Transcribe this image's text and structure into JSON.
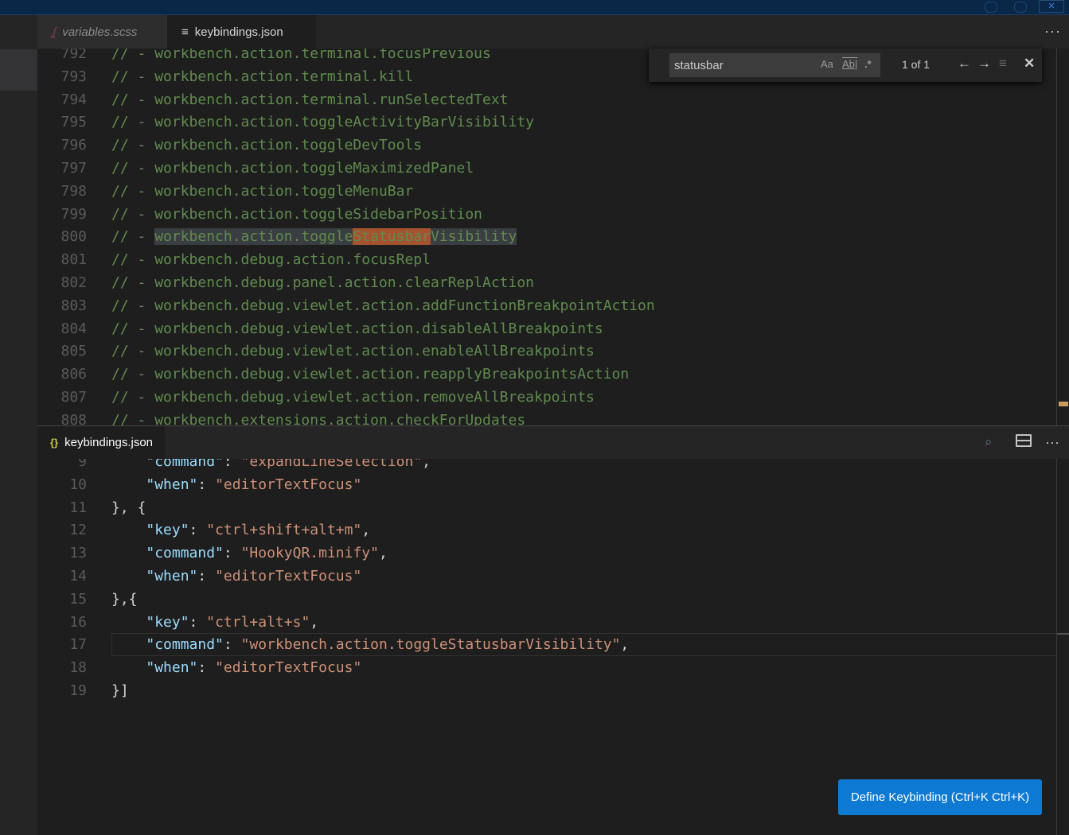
{
  "colors": {
    "accent": "#0e7ad3",
    "comment": "#608b4e",
    "json_key": "#9cdcfe",
    "json_string": "#ce9178",
    "match_highlight": "#a5532f"
  },
  "titlebar": {
    "close_label": "✕"
  },
  "tabs": [
    {
      "label": "variables.scss",
      "icon": "sass-icon",
      "active": false
    },
    {
      "label": "keybindings.json",
      "icon": "file-lines-icon",
      "active": true
    }
  ],
  "tabs_more": "···",
  "find": {
    "value": "statusbar",
    "match_case": "Aa",
    "whole_word": "Ab|",
    "regex": ".*",
    "count": "1 of 1",
    "prev": "←",
    "next": "→",
    "selection": "≡",
    "close": "✕"
  },
  "top_editor": {
    "lines": [
      {
        "n": "792",
        "prefix": "// - ",
        "text": "workbench.action.terminal.focusPrevious"
      },
      {
        "n": "793",
        "prefix": "// - ",
        "text": "workbench.action.terminal.kill"
      },
      {
        "n": "794",
        "prefix": "// - ",
        "text": "workbench.action.terminal.runSelectedText"
      },
      {
        "n": "795",
        "prefix": "// - ",
        "text": "workbench.action.toggleActivityBarVisibility"
      },
      {
        "n": "796",
        "prefix": "// - ",
        "text": "workbench.action.toggleDevTools"
      },
      {
        "n": "797",
        "prefix": "// - ",
        "text": "workbench.action.toggleMaximizedPanel"
      },
      {
        "n": "798",
        "prefix": "// - ",
        "text": "workbench.action.toggleMenuBar"
      },
      {
        "n": "799",
        "prefix": "// - ",
        "text": "workbench.action.toggleSidebarPosition"
      },
      {
        "n": "800",
        "prefix": "// - ",
        "text_pre": "workbench.action.toggle",
        "text_match": "Statusbar",
        "text_post": "Visibility"
      },
      {
        "n": "801",
        "prefix": "// - ",
        "text": "workbench.debug.action.focusRepl"
      },
      {
        "n": "802",
        "prefix": "// - ",
        "text": "workbench.debug.panel.action.clearReplAction"
      },
      {
        "n": "803",
        "prefix": "// - ",
        "text": "workbench.debug.viewlet.action.addFunctionBreakpointAction"
      },
      {
        "n": "804",
        "prefix": "// - ",
        "text": "workbench.debug.viewlet.action.disableAllBreakpoints"
      },
      {
        "n": "805",
        "prefix": "// - ",
        "text": "workbench.debug.viewlet.action.enableAllBreakpoints"
      },
      {
        "n": "806",
        "prefix": "// - ",
        "text": "workbench.debug.viewlet.action.reapplyBreakpointsAction"
      },
      {
        "n": "807",
        "prefix": "// - ",
        "text": "workbench.debug.viewlet.action.removeAllBreakpoints"
      },
      {
        "n": "808",
        "prefix": "// - ",
        "text": "workbench.extensions.action.checkForUpdates"
      }
    ]
  },
  "panel": {
    "tab_label": "keybindings.json",
    "tab_icon": "{}",
    "more": "···"
  },
  "bottom_editor": {
    "lines": [
      {
        "n": "9",
        "indent": "    ",
        "key": "\"command\"",
        "sep": ": ",
        "value": "\"expandLineSelection\"",
        "tail": ","
      },
      {
        "n": "10",
        "indent": "    ",
        "key": "\"when\"",
        "sep": ": ",
        "value": "\"editorTextFocus\"",
        "tail": ""
      },
      {
        "n": "11",
        "indent": "",
        "punc": "}, {"
      },
      {
        "n": "12",
        "indent": "    ",
        "key": "\"key\"",
        "sep": ": ",
        "value": "\"ctrl+shift+alt+m\"",
        "tail": ","
      },
      {
        "n": "13",
        "indent": "    ",
        "key": "\"command\"",
        "sep": ": ",
        "value": "\"HookyQR.minify\"",
        "tail": ","
      },
      {
        "n": "14",
        "indent": "    ",
        "key": "\"when\"",
        "sep": ": ",
        "value": "\"editorTextFocus\"",
        "tail": ""
      },
      {
        "n": "15",
        "indent": "",
        "punc": "},{"
      },
      {
        "n": "16",
        "indent": "    ",
        "key": "\"key\"",
        "sep": ": ",
        "value": "\"ctrl+alt+s\"",
        "tail": ","
      },
      {
        "n": "17",
        "indent": "    ",
        "key": "\"command\"",
        "sep": ": ",
        "value": "\"workbench.action.toggleStatusbarVisibility\"",
        "tail": ","
      },
      {
        "n": "18",
        "indent": "    ",
        "key": "\"when\"",
        "sep": ": ",
        "value": "\"editorTextFocus\"",
        "tail": ""
      },
      {
        "n": "19",
        "indent": "",
        "punc": "}]"
      }
    ]
  },
  "define_keybinding_label": "Define Keybinding (Ctrl+K Ctrl+K)"
}
